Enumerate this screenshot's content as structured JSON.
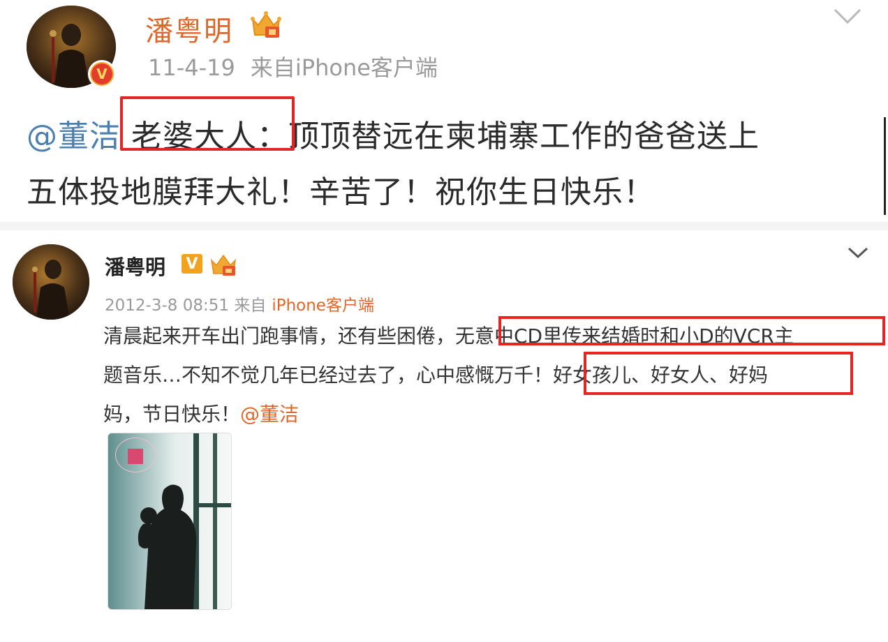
{
  "post1": {
    "username": "潘粤明",
    "date": "11-4-19",
    "source": "来自iPhone客户端",
    "mention": "@董洁",
    "text_part1": " 老婆大人：顶顶替远在柬埔寨工作的爸爸送上",
    "text_line2": "五体投地膜拜大礼！辛苦了！祝你生日快乐！",
    "verified_badge": "V",
    "icons": [
      "crown-icon",
      "chevron-down-icon",
      "verified-icon"
    ]
  },
  "post2": {
    "username": "潘粤明",
    "verified_badge": "V",
    "datetime": "2012-3-8 08:51",
    "from_label": "来自",
    "source": "iPhone客户端",
    "line1": "清晨起来开车出门跑事情，还有些困倦，无意中CD里传来结婚时和小D的VCR主",
    "line2": "题音乐…不知不觉几年已经过去了，心中感慨万千！好女孩儿、好女人、好妈",
    "line3_text": "妈，节日快乐！",
    "mention": "@董洁",
    "icons": [
      "crown-icon",
      "chevron-down-icon",
      "verified-icon"
    ]
  },
  "colors": {
    "accent_orange": "#e0672a",
    "mention_blue": "#4a7fb0",
    "highlight_red": "#e52424",
    "meta_gray": "#9a9a9a"
  }
}
